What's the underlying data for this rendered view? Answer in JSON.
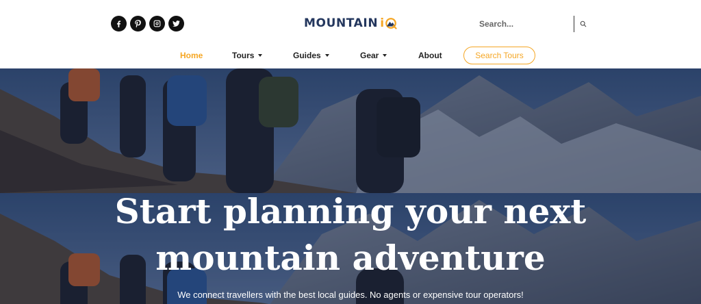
{
  "header": {
    "social": [
      {
        "icon": "facebook-icon",
        "label": "f"
      },
      {
        "icon": "pinterest-icon",
        "label": "P"
      },
      {
        "icon": "instagram-icon",
        "label": "ig"
      },
      {
        "icon": "twitter-icon",
        "label": "tw"
      }
    ],
    "logo": {
      "word": "MOUNTAIN",
      "suffix": "i"
    },
    "search": {
      "placeholder": "Search..."
    }
  },
  "nav": {
    "items": [
      {
        "label": "Home",
        "active": true,
        "dropdown": false
      },
      {
        "label": "Tours",
        "active": false,
        "dropdown": true
      },
      {
        "label": "Guides",
        "active": false,
        "dropdown": true
      },
      {
        "label": "Gear",
        "active": false,
        "dropdown": true
      },
      {
        "label": "About",
        "active": false,
        "dropdown": false
      }
    ],
    "cta": "Search Tours"
  },
  "hero": {
    "headline_line1": "Start planning your next",
    "headline_line2": "mountain adventure",
    "subtitle": "We connect travellers with the best local guides. No agents or expensive tour operators!"
  },
  "colors": {
    "accent": "#f5a623",
    "brand": "#24375e",
    "text": "#222222"
  }
}
